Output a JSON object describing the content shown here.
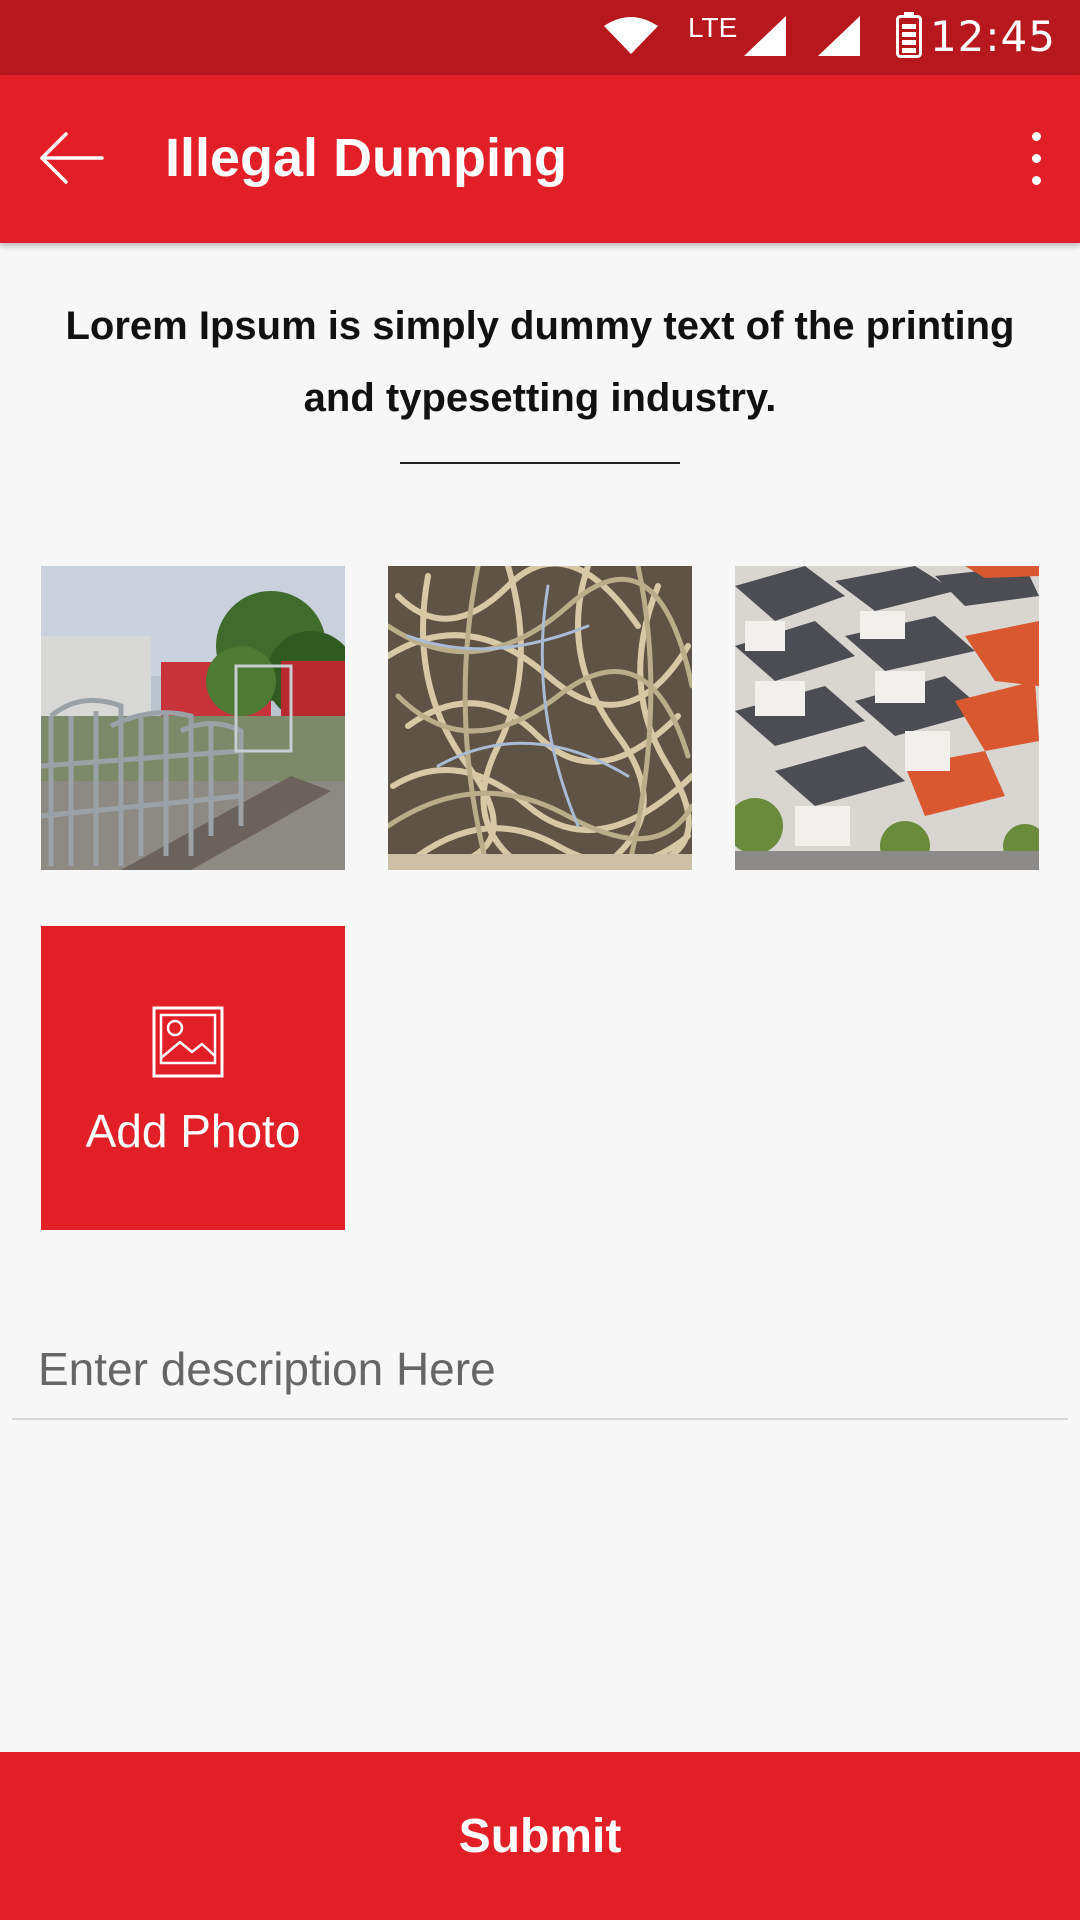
{
  "status_bar": {
    "network_label": "LTE",
    "time": "12:45"
  },
  "app_bar": {
    "title": "Illegal Dumping",
    "back_icon": "arrow-back-icon",
    "menu_icon": "more-vert-icon"
  },
  "intro": {
    "headline": "Lorem Ipsum is simply dummy text of the printing and typesetting industry."
  },
  "photos": [
    {
      "subject": "fences-and-container"
    },
    {
      "subject": "shredded-paper"
    },
    {
      "subject": "rooftops"
    }
  ],
  "add_photo": {
    "label": "Add Photo",
    "icon": "image-icon"
  },
  "description": {
    "placeholder": "Enter description Here",
    "value": ""
  },
  "submit": {
    "label": "Submit"
  },
  "colors": {
    "primary": "#e21e26",
    "status_bar": "#b7181e",
    "background": "#f7f7f7"
  }
}
